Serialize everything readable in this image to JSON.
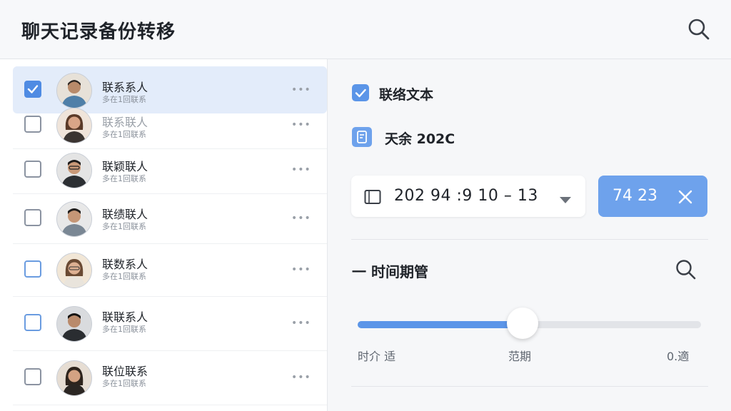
{
  "header": {
    "title": "聊天记录备份转移",
    "search_icon": "search-icon"
  },
  "contacts": [
    {
      "name": "联系系人",
      "sub": "多在1回联系",
      "checked": true,
      "selected": true,
      "avatar_icon": "person-avatar"
    },
    {
      "name": "联系联人",
      "sub": "多在1回联系",
      "checked": false,
      "selected": false,
      "avatar_icon": "person-avatar"
    },
    {
      "name": "联颖联人",
      "sub": "多在1回联系",
      "checked": false,
      "selected": false,
      "avatar_icon": "person-avatar"
    },
    {
      "name": "联绩联人",
      "sub": "多在1回联系",
      "checked": false,
      "selected": false,
      "avatar_icon": "person-avatar"
    },
    {
      "name": "联数系人",
      "sub": "多在1回联系",
      "checked": false,
      "selected": false,
      "avatar_icon": "person-avatar"
    },
    {
      "name": "联联系人",
      "sub": "多在1回联系",
      "checked": false,
      "selected": false,
      "avatar_icon": "person-avatar"
    },
    {
      "name": "联位联系",
      "sub": "多在1回联系",
      "checked": false,
      "selected": false,
      "avatar_icon": "person-avatar"
    }
  ],
  "panel": {
    "option1_label": "联络文本",
    "option2_label": "天余 202C",
    "date_range": "202 94 :9 10 – 13",
    "button_label": "74 23",
    "section_title": "一 时间期管",
    "slider": {
      "value_fraction": 0.48,
      "label_left": "时介 适",
      "label_mid": "范期",
      "label_right": "0.適"
    }
  },
  "colors": {
    "accent": "#5b95e8",
    "accent_light": "#6ea2ec",
    "selected_row": "#e3ecfa"
  }
}
